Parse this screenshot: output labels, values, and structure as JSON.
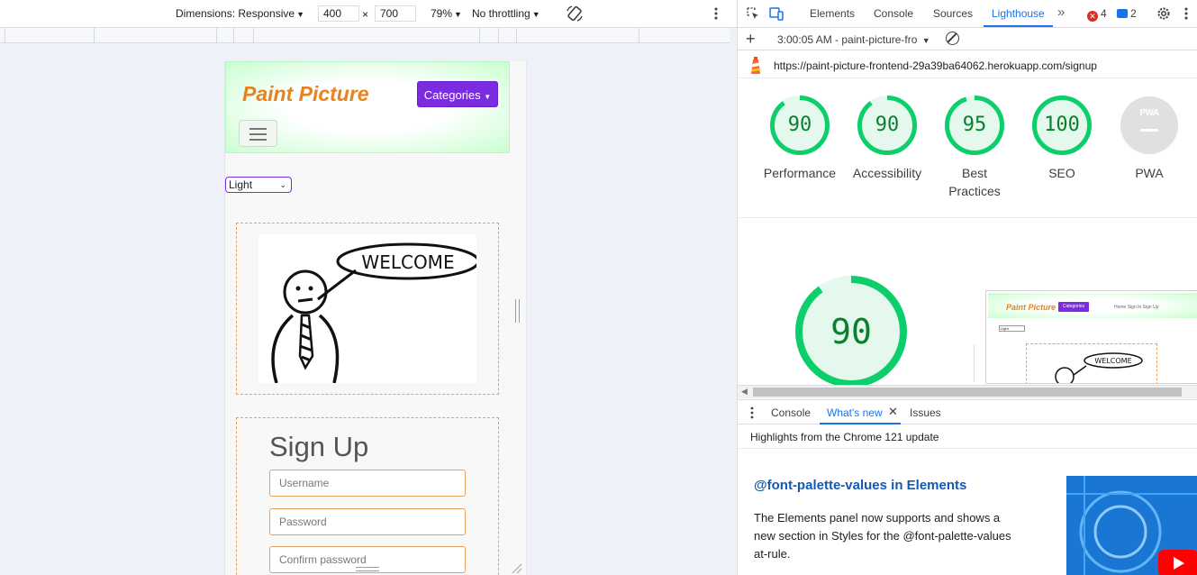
{
  "device_toolbar": {
    "dimensions_label": "Dimensions: Responsive",
    "width": "400",
    "times": "×",
    "height": "700",
    "zoom": "79%",
    "throttling": "No throttling"
  },
  "site": {
    "brand": "Paint Picture",
    "categories_label": "Categories",
    "theme_selected": "Light",
    "welcome_bubble_text": "WELCOME",
    "signup": {
      "title": "Sign Up",
      "username_placeholder": "Username",
      "password_placeholder": "Password",
      "confirm_placeholder": "Confirm password"
    }
  },
  "devtools": {
    "tabs": [
      "Elements",
      "Console",
      "Sources",
      "Lighthouse"
    ],
    "active_tab": "Lighthouse",
    "errors_count": "4",
    "messages_count": "2",
    "report_select": "3:00:05 AM - paint-picture-fro",
    "audited_url": "https://paint-picture-frontend-29a39ba64062.herokuapp.com/signup",
    "scores": [
      {
        "name": "Performance",
        "value": 90
      },
      {
        "name": "Accessibility",
        "value": 90
      },
      {
        "name": "Best Practices",
        "value": 95
      },
      {
        "name": "SEO",
        "value": 100
      }
    ],
    "pwa": {
      "label": "PWA",
      "badge": "PWA"
    },
    "performance_big": 90,
    "thumbnail": {
      "brand": "Paint Picture",
      "categories": "Categories",
      "nav_links": "Home   Sign In   Sign Up",
      "theme": "Light",
      "welcome": "WELCOME"
    },
    "drawer_tabs": [
      "Console",
      "What's new",
      "Issues"
    ],
    "active_drawer_tab": "What's new",
    "highlights": "Highlights from the Chrome 121 update",
    "whats_new_title": "@font-palette-values in Elements",
    "whats_new_body": "The Elements panel now supports and shows a new section in Styles for the @font-palette-values at-rule."
  },
  "colors": {
    "brand_orange": "#e8821e",
    "categories_purple": "#7b2be0",
    "score_green": "#0cce6b",
    "active_blue": "#1a73e8"
  }
}
